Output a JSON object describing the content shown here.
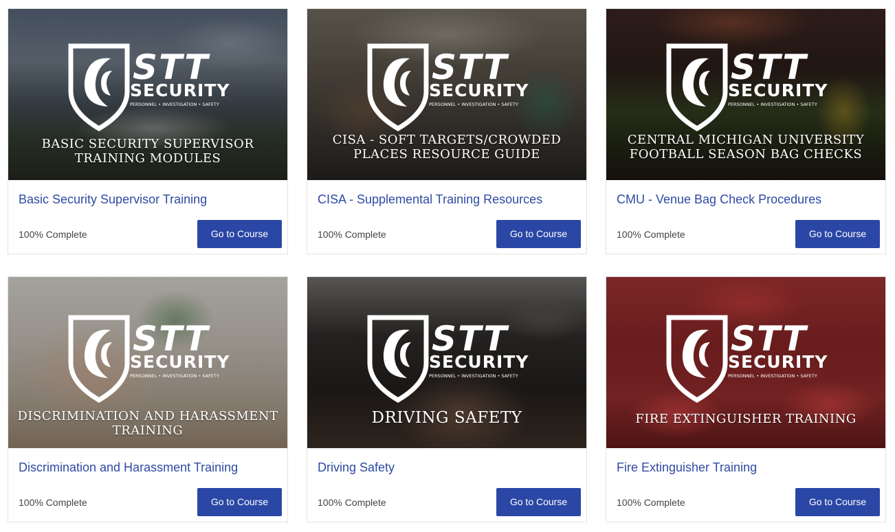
{
  "brand": {
    "name": "STT",
    "sub": "SECURITY",
    "tagline": "PERSONNEL • INVESTIGATION • SAFETY"
  },
  "accent_color": "#2b47a5",
  "title_color": "#2f4aa3",
  "courses": [
    {
      "thumb_text": "Basic Security Supervisor Training Modules",
      "title": "Basic Security Supervisor Training",
      "status": "100% Complete",
      "button": "Go to Course"
    },
    {
      "thumb_text": "CISA - Soft Targets/Crowded Places Resource Guide",
      "title": "CISA - Supplemental Training Resources",
      "status": "100% Complete",
      "button": "Go to Course"
    },
    {
      "thumb_text": "Central Michigan University Football Season Bag Checks",
      "title": "CMU - Venue Bag Check Procedures",
      "status": "100% Complete",
      "button": "Go to Course"
    },
    {
      "thumb_text": "Discrimination and Harassment Training",
      "title": "Discrimination and Harassment Training",
      "status": "100% Complete",
      "button": "Go to Course"
    },
    {
      "thumb_text": "Driving Safety",
      "title": "Driving Safety",
      "status": "100% Complete",
      "button": "Go to Course"
    },
    {
      "thumb_text": "Fire Extinguisher Training",
      "title": "Fire Extinguisher Training",
      "status": "100% Complete",
      "button": "Go to Course"
    }
  ]
}
